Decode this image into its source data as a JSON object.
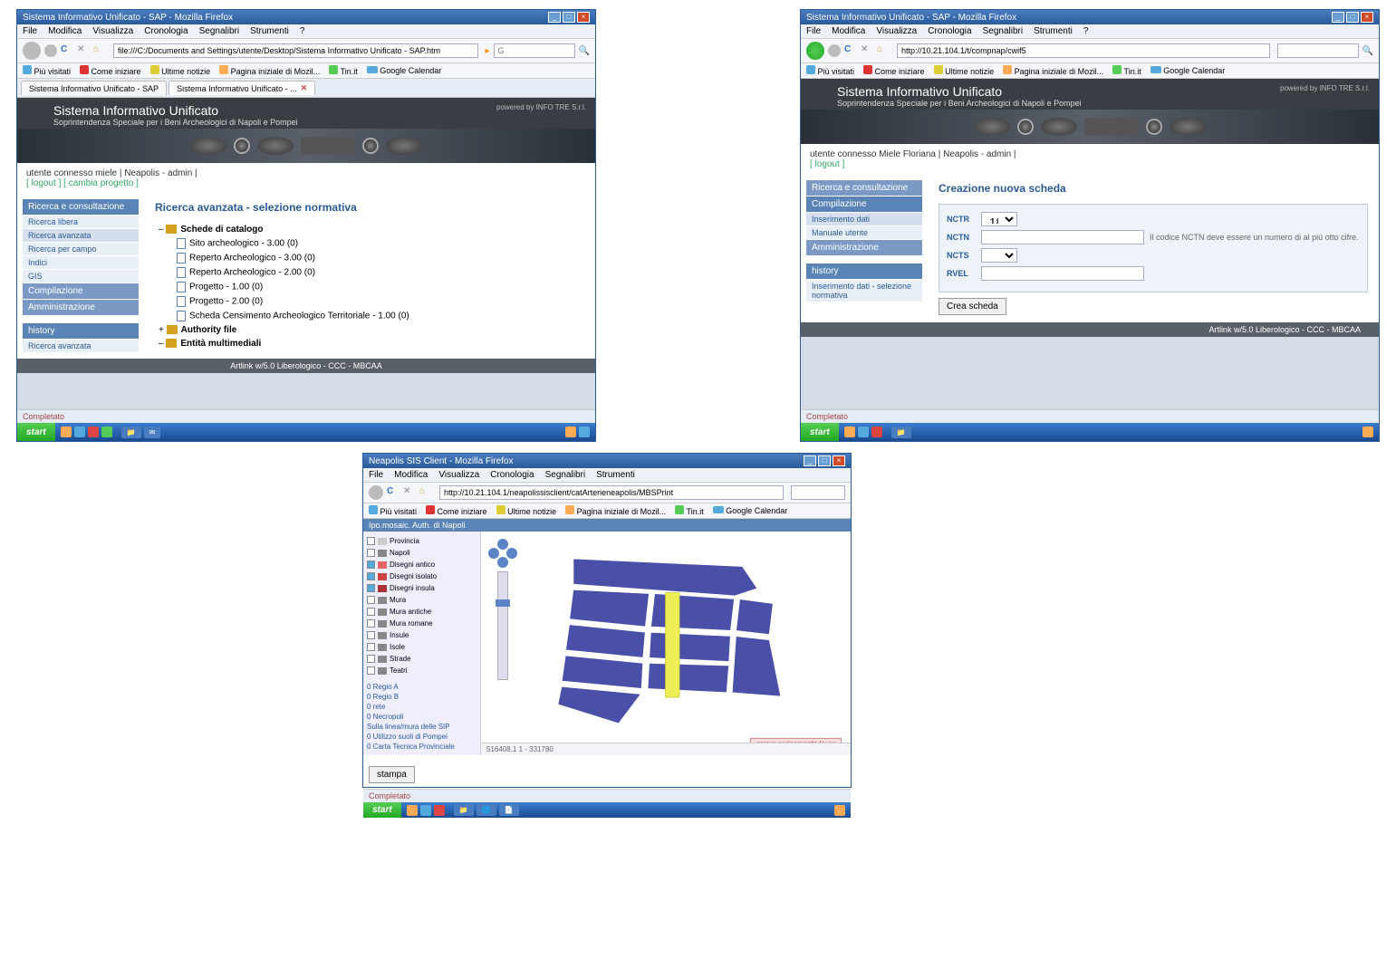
{
  "win1": {
    "title": "Sistema Informativo Unificato - SAP - Mozilla Firefox",
    "menu": [
      "File",
      "Modifica",
      "Visualizza",
      "Cronologia",
      "Segnalibri",
      "Strumenti",
      "?"
    ],
    "url": "file:///C:/Documents and Settings/utente/Desktop/Sistema Informativo Unificato - SAP.htm",
    "bookmarks": [
      "Più visitati",
      "Come iniziare",
      "Ultime notizie",
      "Pagina iniziale di Mozil...",
      "Tin.it",
      "Google Calendar"
    ],
    "tabs": [
      "Sistema Informativo Unificato - SAP",
      "Sistema Informativo Unificato - ..."
    ],
    "banner_title": "Sistema Informativo Unificato",
    "banner_sub": "Soprintendenza Speciale per i Beni Archeologici di Napoli e Pompei",
    "banner_right": "powered by INFO TRE S.r.l.",
    "status_user": "utente connesso miele | Neapolis - admin |",
    "status_links": "[ logout ] [ cambia progetto ]",
    "sidebar": {
      "s1": "Ricerca e consultazione",
      "items1": [
        "Ricerca libera",
        "Ricerca avanzata",
        "Ricerca per campo",
        "Indici",
        "GIS"
      ],
      "s2": "Compilazione",
      "s3": "Amministrazione",
      "s4": "history",
      "items4": [
        "Ricerca avanzata"
      ]
    },
    "main_title": "Ricerca avanzata - selezione normativa",
    "tree": {
      "root": "Schede di catalogo",
      "items": [
        "Sito archeologico - 3.00 (0)",
        "Reperto Archeologico - 3.00 (0)",
        "Reperto Archeologico - 2.00 (0)",
        "Progetto - 1.00 (0)",
        "Progetto - 2.00 (0)",
        "Scheda Censimento Archeologico Territoriale - 1.00 (0)"
      ],
      "auth": "Authority file",
      "entita": "Entità multimediali"
    },
    "footer": "Artlink w/5.0 Liberologico - CCC - MBCAA",
    "statusbar": "Completato"
  },
  "win2": {
    "title": "Sistema Informativo Unificato - SAP - Mozilla Firefox",
    "url": "http://10.21.104.1/t/compnap/cwif5",
    "status_user": "utente connesso Miele Floriana | Neapolis - admin |",
    "status_links": "[ logout ]",
    "sidebar": {
      "s1": "Ricerca e consultazione",
      "s2": "Compilazione",
      "items2": [
        "Inserimento dati",
        "Manuale utente"
      ],
      "s3": "Amministrazione",
      "s4": "history",
      "items4": [
        "Inserimento dati - selezione normativa"
      ]
    },
    "main_title": "Creazione nuova scheda",
    "form": {
      "f1": "NCTR",
      "v1": "18",
      "f2": "NCTN",
      "hint": "Il codice NCTN deve essere un numero di al più otto cifre.",
      "f3": "NCTS",
      "f4": "RVEL",
      "btn": "Crea scheda"
    },
    "footer": "Artlink w/5.0 Liberologico - CCC - MBCAA"
  },
  "win3": {
    "title": "Neapolis SIS Client - Mozilla Firefox",
    "url": "http://10.21.104.1/neapolissisclient/catArterieneapolis/MBSPrint",
    "sidebar_title": "Ipo.mosaic. Auth. di Napoli",
    "layers": [
      {
        "name": "Provincia",
        "on": false,
        "color": "#ccc"
      },
      {
        "name": "Napoli",
        "on": false,
        "color": "#888"
      },
      {
        "name": "Disegni antico",
        "on": true,
        "color": "#e66"
      },
      {
        "name": "Disegni isolato",
        "on": true,
        "color": "#c44"
      },
      {
        "name": "Disegni insula",
        "on": true,
        "color": "#a33"
      },
      {
        "name": "Mura",
        "on": false,
        "color": "#888"
      },
      {
        "name": "Mura antiche",
        "on": false,
        "color": "#888"
      },
      {
        "name": "Mura romane",
        "on": false,
        "color": "#888"
      },
      {
        "name": "Insule",
        "on": false,
        "color": "#888"
      },
      {
        "name": "Isole",
        "on": false,
        "color": "#888"
      },
      {
        "name": "Strade",
        "on": false,
        "color": "#888"
      },
      {
        "name": "Teatri",
        "on": false,
        "color": "#888"
      }
    ],
    "sidebar_links": [
      "0 Regio A",
      "0 Regio B",
      "0 rete",
      "0 Necropoli",
      "Sulla linea/mura delle SIP",
      "0 Utilizzo suoli di Pompei",
      "0 Carta Tecnica Provinciale"
    ],
    "coords": "516408.1 1 - 331780",
    "btn": "stampa",
    "warn": "errore caricamento layer"
  },
  "taskbar": {
    "start": "start"
  }
}
